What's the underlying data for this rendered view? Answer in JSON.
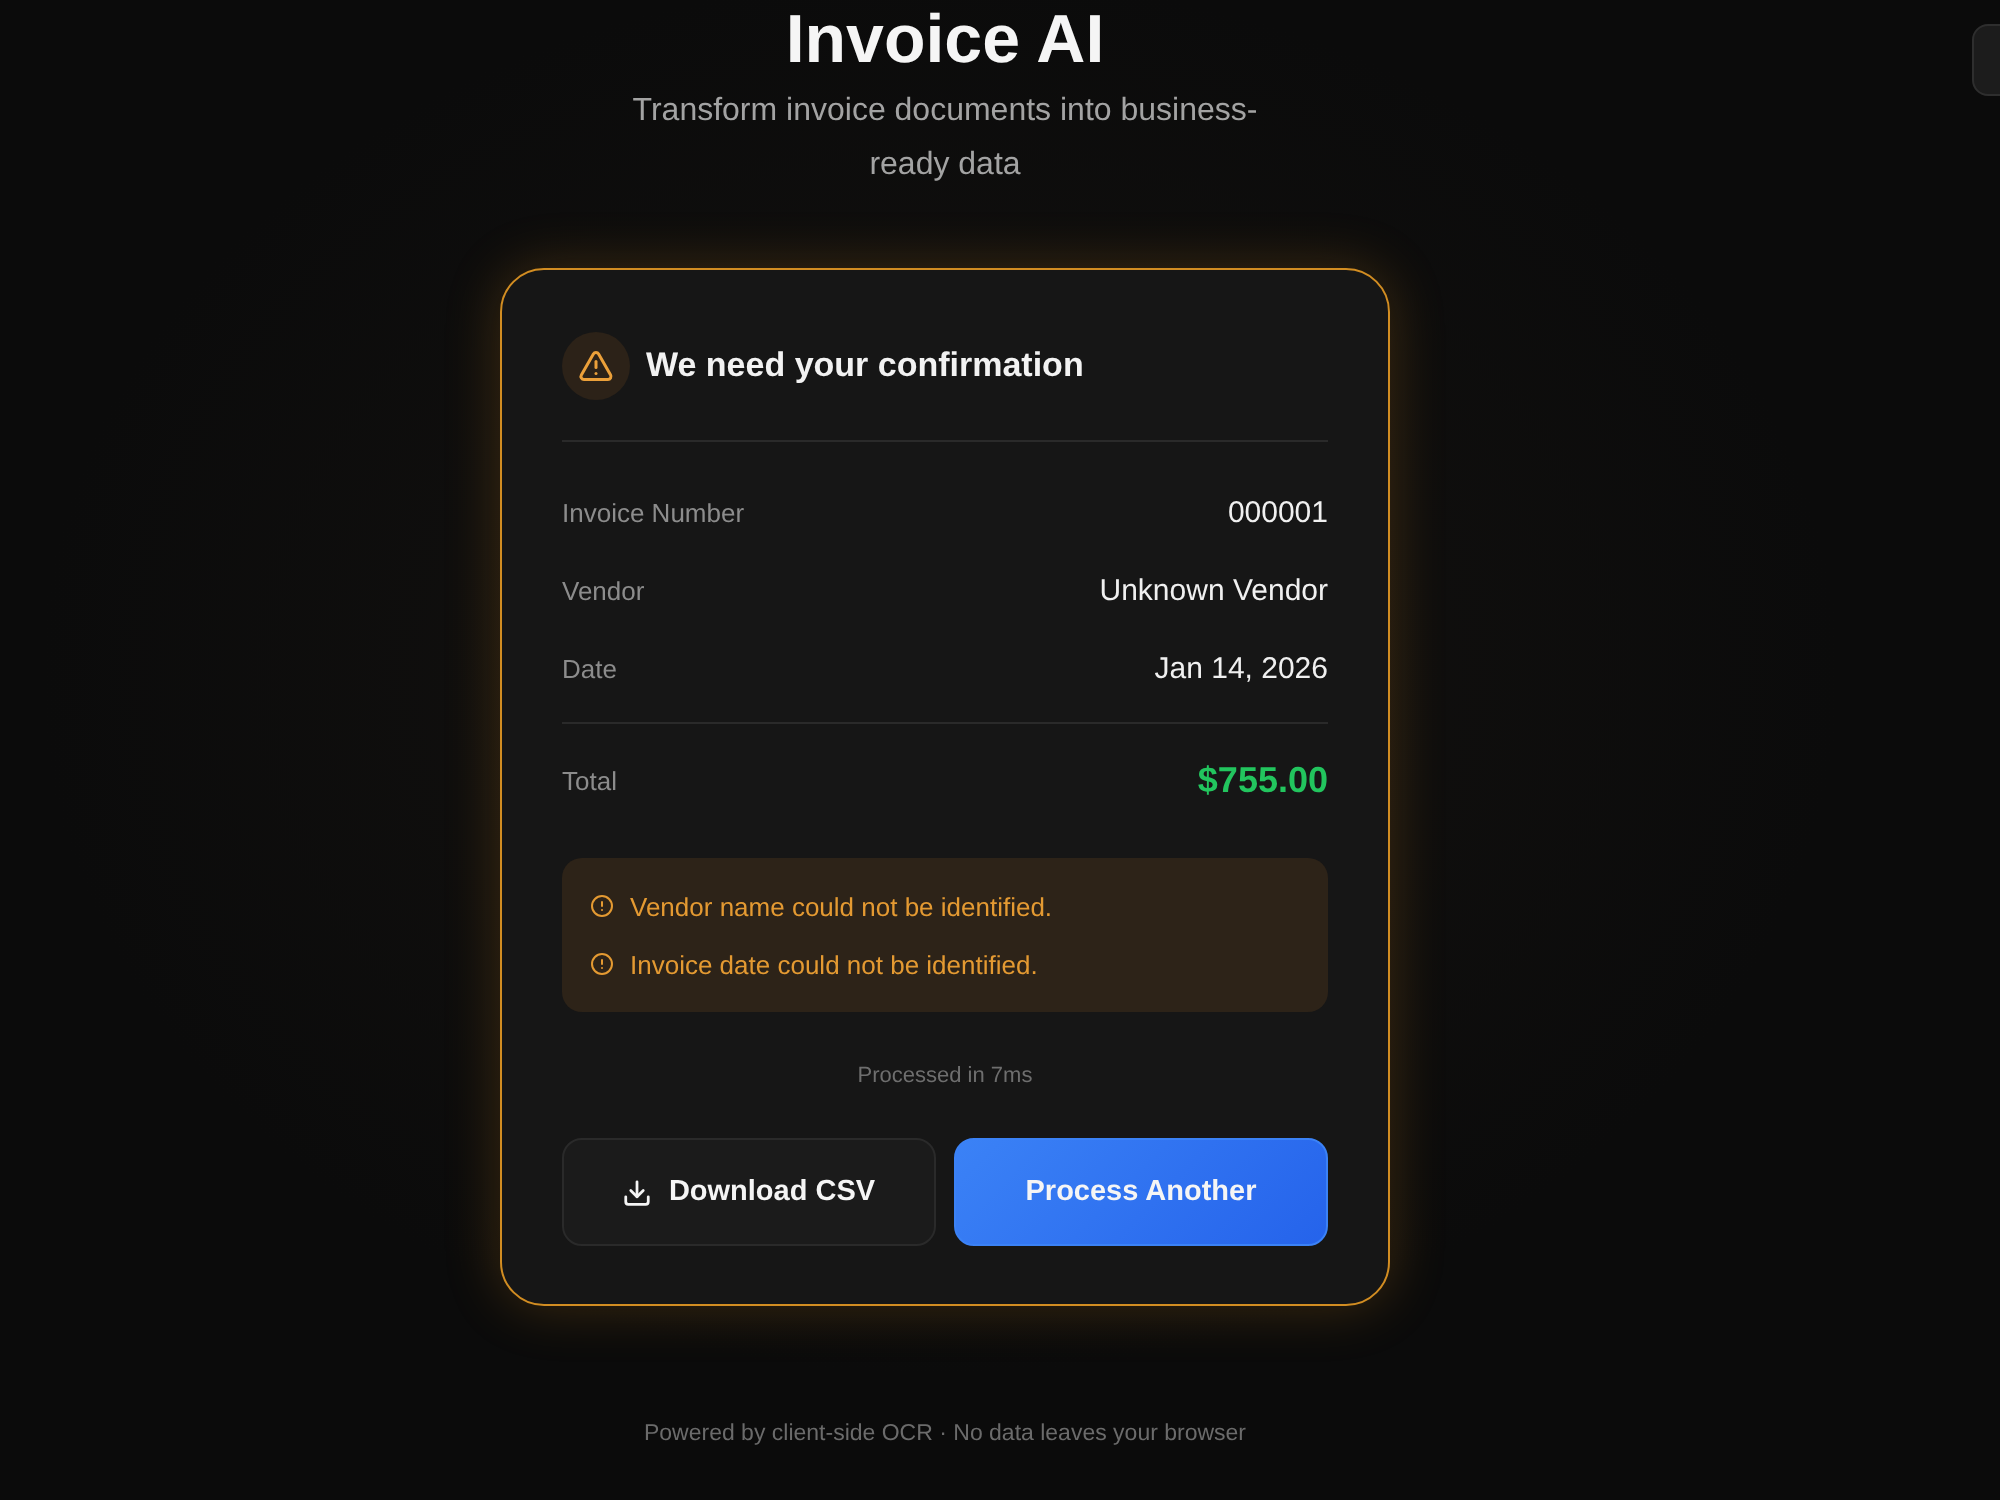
{
  "header": {
    "title": "Invoice AI",
    "subtitle": "Transform invoice documents into business-ready data"
  },
  "card": {
    "title": "We need your confirmation",
    "fields": [
      {
        "label": "Invoice Number",
        "value": "000001"
      },
      {
        "label": "Vendor",
        "value": "Unknown Vendor"
      },
      {
        "label": "Date",
        "value": "Jan 14, 2026"
      }
    ],
    "total": {
      "label": "Total",
      "value": "$755.00"
    },
    "warnings": [
      "Vendor name could not be identified.",
      "Invoice date could not be identified."
    ],
    "processed": "Processed in 7ms",
    "buttons": [
      {
        "label": "Download CSV",
        "kind": "secondary"
      },
      {
        "label": "Process Another",
        "kind": "primary"
      }
    ]
  },
  "footer": "Powered by client-side OCR · No data leaves your browser"
}
